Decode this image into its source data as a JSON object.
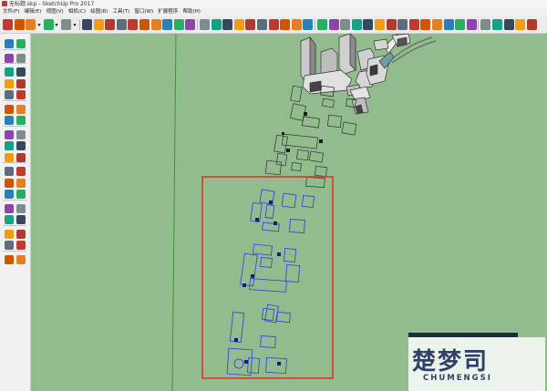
{
  "window": {
    "title": "无标题.skp - SketchUp Pro 2017"
  },
  "menu": [
    "文件(F)",
    "编辑(E)",
    "视图(V)",
    "相机(C)",
    "绘图(R)",
    "工具(T)",
    "窗口(W)",
    "扩展程序",
    "帮助(H)"
  ],
  "watermark": {
    "main": "楚梦司",
    "sub": "CHUMENGSI"
  },
  "colors": {
    "viewport_bg": "#93bc8e",
    "selection_blue": "#2a3ee0",
    "highlight_box": "#e0362a",
    "axis_green": "#3f8f3a",
    "toolbar_bg": "#ececec"
  },
  "icons": {
    "toolbar": [
      "select-arrow-icon",
      "eraser-icon",
      "pencil-icon",
      "dropdown-arrow-icon",
      "arc-icon",
      "dropdown-arrow-icon",
      "paint-bucket-icon",
      "dropdown-arrow-icon",
      "push-pull-icon",
      "move-icon",
      "rotate-icon",
      "scale-icon",
      "offset-icon",
      "follow-me-icon",
      "tape-measure-icon",
      "dimension-icon",
      "protractor-icon",
      "text-icon",
      "axes-icon",
      "3d-text-icon",
      "orbit-icon",
      "pan-icon",
      "zoom-icon",
      "zoom-extents-icon",
      "previous-view-icon",
      "warehouse-icon",
      "extension-warehouse-icon",
      "share-model-icon",
      "iso-view-icon",
      "top-view-icon",
      "front-view-icon",
      "right-view-icon",
      "back-view-icon",
      "left-view-icon",
      "xray-icon",
      "back-edges-icon",
      "wireframe-icon",
      "hidden-line-icon",
      "shaded-icon",
      "textured-icon",
      "monochrome-icon",
      "section-plane-icon",
      "select-arrow-icon",
      "component-icon",
      "group-icon",
      "layer-icon",
      "settings-icon"
    ],
    "left": [
      "select-arrow-icon",
      "make-component-icon",
      "paint-bucket-icon",
      "eraser-icon",
      "line-icon",
      "freehand-icon",
      "rectangle-icon",
      "rotated-rectangle-icon",
      "circle-icon",
      "polygon-icon",
      "arc-icon",
      "two-point-arc-icon",
      "three-point-arc-icon",
      "pie-icon",
      "move-icon",
      "push-pull-icon",
      "rotate-icon",
      "follow-me-icon",
      "scale-icon",
      "offset-icon",
      "tape-measure-icon",
      "dimension-icon",
      "protractor-icon",
      "text-icon",
      "axes-icon",
      "3d-text-icon",
      "orbit-icon",
      "pan-icon",
      "zoom-icon",
      "zoom-window-icon",
      "zoom-extents-icon",
      "previous-icon",
      "position-camera-icon",
      "look-around-icon",
      "walk-icon",
      "section-plane-icon"
    ]
  }
}
